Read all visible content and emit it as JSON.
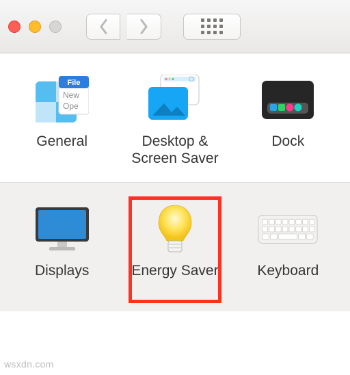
{
  "toolbar": {
    "traffic_lights": [
      "close",
      "minimize",
      "zoom"
    ],
    "back_label": "Back",
    "forward_label": "Forward",
    "show_all_label": "Show All"
  },
  "row1": {
    "items": [
      {
        "label": "General"
      },
      {
        "label": "Desktop & Screen Saver"
      },
      {
        "label": "Dock"
      }
    ]
  },
  "row2": {
    "items": [
      {
        "label": "Displays"
      },
      {
        "label": "Energy Saver",
        "highlighted": true
      },
      {
        "label": "Keyboard"
      }
    ]
  },
  "general_icon_text": {
    "file": "File",
    "new": "New",
    "open": "Ope"
  },
  "watermark": "wsxdn.com"
}
